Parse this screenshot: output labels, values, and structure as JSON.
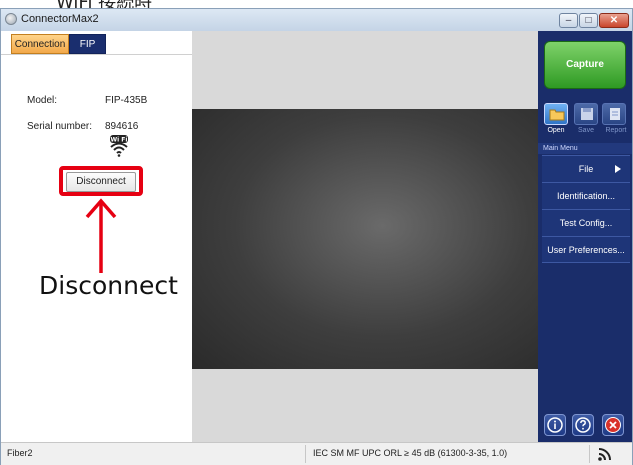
{
  "page_heading_partial": "WiFi 接続時",
  "window": {
    "title": "ConnectorMax2",
    "minimize_glyph": "–",
    "maximize_glyph": "□",
    "close_glyph": "✕"
  },
  "tabs": [
    "Connection",
    "FIP"
  ],
  "device_info": {
    "model_label": "Model:",
    "model_value": "FIP-435B",
    "serial_label": "Serial number:",
    "serial_value": "894616",
    "wifi_badge": "Wi Fi"
  },
  "disconnect_button": "Disconnect",
  "annotation": "Disconnect",
  "right_panel": {
    "capture": "Capture",
    "tools": [
      "Open",
      "Save",
      "Report"
    ],
    "menu_header": "Main Menu",
    "menu_items": [
      "File",
      "Identification...",
      "Test Config...",
      "User Preferences..."
    ]
  },
  "status_bar": {
    "left": "Fiber2",
    "center": "IEC SM MF UPC ORL ≥ 45 dB (61300-3-35, 1.0)"
  },
  "colors": {
    "highlight": "#e60012",
    "active_tab": "#f2a84a",
    "fip_tab": "#1a2e6e",
    "right_panel_bg": "#1a2d6a",
    "capture_green": "#2e9a23",
    "exit_red": "#d9322a"
  }
}
